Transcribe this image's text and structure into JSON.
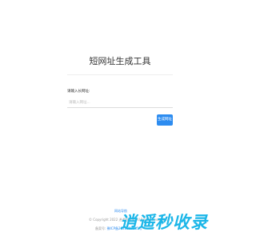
{
  "page": {
    "title": "短网址生成工具"
  },
  "form": {
    "label": "请输入长网址:",
    "placeholder": "请输入网址...",
    "button_label": "生成网址"
  },
  "footer": {
    "link_text": "网站导航",
    "copyright": "© Copyright 2022 逍遥秒收录 All Rights Reserved",
    "icp_prefix": "备案号:",
    "icp_link": "豫ICP备2021012345号"
  },
  "watermark": {
    "text": "逍遥秒收录"
  },
  "colors": {
    "accent": "#2d8cf0",
    "watermark": "#1bb6e8"
  }
}
